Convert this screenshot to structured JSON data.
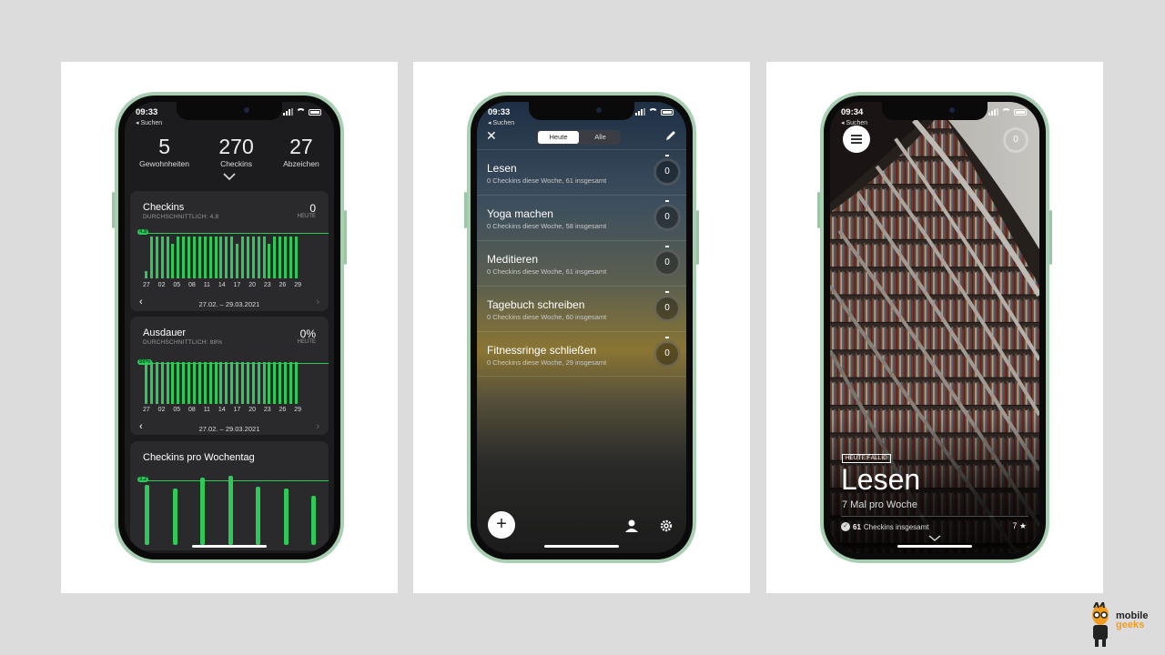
{
  "common": {
    "back": "◂ Suchen"
  },
  "phone1": {
    "time": "09:33",
    "stats": [
      {
        "num": "5",
        "label": "Gewohnheiten"
      },
      {
        "num": "270",
        "label": "Checkins"
      },
      {
        "num": "27",
        "label": "Abzeichen"
      }
    ],
    "panel1": {
      "title": "Checkins",
      "sub": "DURCHSCHNITTLICH: 4,8",
      "value": "0",
      "heute": "HEUTE",
      "avg_tag": "4.8",
      "range": "27.02. – 29.03.2021",
      "ticks": [
        "27",
        "02",
        "05",
        "08",
        "11",
        "14",
        "17",
        "20",
        "23",
        "26",
        "29"
      ]
    },
    "panel2": {
      "title": "Ausdauer",
      "sub": "DURCHSCHNITTLICH: 88%",
      "value": "0%",
      "heute": "HEUTE",
      "avg_tag": "88%",
      "range": "27.02. – 29.03.2021",
      "ticks": [
        "27",
        "02",
        "05",
        "08",
        "11",
        "14",
        "17",
        "20",
        "23",
        "26",
        "29"
      ]
    },
    "panel3": {
      "title": "Checkins pro Wochentag",
      "avg_tag": "3.2"
    }
  },
  "phone2": {
    "time": "09:33",
    "tabs": {
      "today": "Heute",
      "all": "Alle"
    },
    "habits": [
      {
        "name": "Lesen",
        "sub": "0 Checkins diese Woche, 61 insgesamt",
        "count": "0"
      },
      {
        "name": "Yoga machen",
        "sub": "0 Checkins diese Woche, 58 insgesamt",
        "count": "0"
      },
      {
        "name": "Meditieren",
        "sub": "0 Checkins diese Woche, 61 insgesamt",
        "count": "0"
      },
      {
        "name": "Tagebuch schreiben",
        "sub": "0 Checkins diese Woche, 60 insgesamt",
        "count": "0"
      },
      {
        "name": "Fitnessringe schließen",
        "sub": "0 Checkins diese Woche, 29 insgesamt",
        "count": "0"
      }
    ]
  },
  "phone3": {
    "time": "09:34",
    "ring": "0",
    "badge": "HEUTE FÄLLIG",
    "title": "Lesen",
    "freq": "7 Mal pro Woche",
    "total_num": "61",
    "total_label": "Checkins insgesamt",
    "stars": "7 ★"
  },
  "logo": {
    "line1": "mobile",
    "line2": "geeks"
  }
}
